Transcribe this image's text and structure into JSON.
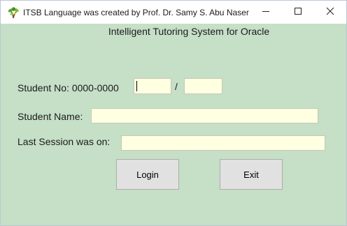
{
  "window": {
    "title": "ITSB Language was created by Prof. Dr. Samy S. Abu Naser",
    "icon": "plant-icon",
    "controls": {
      "minimize": "minimize-icon",
      "maximize": "maximize-icon",
      "close": "close-icon"
    }
  },
  "form": {
    "heading": "Intelligent Tutoring System for Oracle",
    "student_no_label": "Student No: 0000-0000",
    "separator": "/",
    "student_no_part1": "",
    "student_no_part2": "",
    "student_name_label": "Student Name:",
    "student_name_value": "",
    "last_session_label": "Last Session was on:",
    "last_session_value": "",
    "login_label": "Login",
    "exit_label": "Exit"
  },
  "colors": {
    "background": "#c6dfc7",
    "field_background": "#ffffe1",
    "focus_border": "#3c7fd8",
    "button_face": "#e1e1e1"
  }
}
